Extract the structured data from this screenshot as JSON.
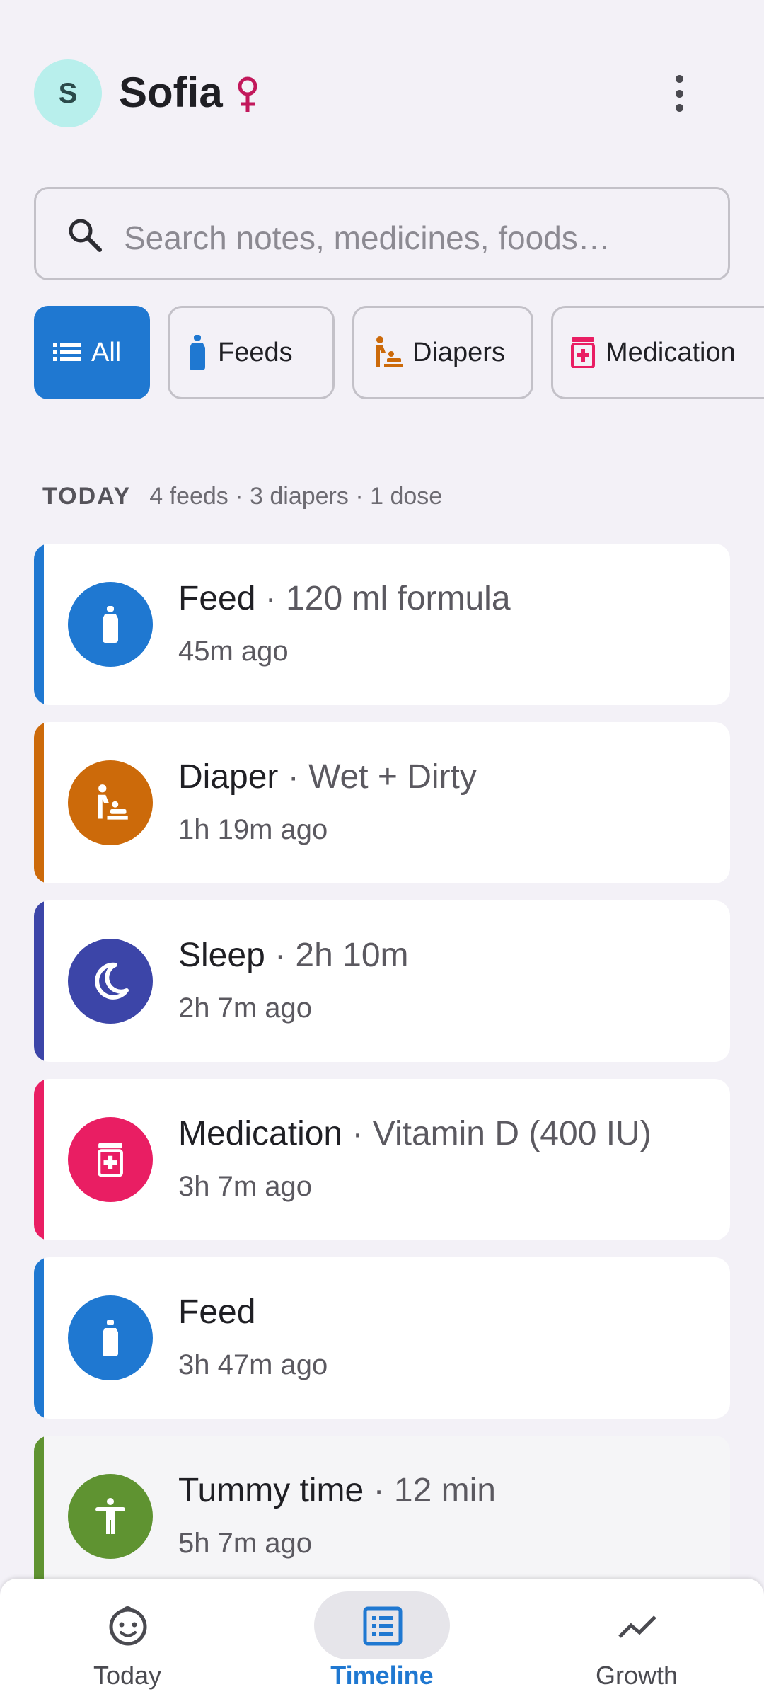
{
  "header": {
    "avatar_initial": "S",
    "baby_name": "Sofia",
    "gender_symbol_color": "#c2185b"
  },
  "search": {
    "placeholder": "Search notes, medicines, foods…"
  },
  "filters": [
    {
      "label": "All",
      "icon": "list-icon",
      "active": true
    },
    {
      "label": "Feeds",
      "icon": "bottle-icon",
      "active": false,
      "color": "#1f78d1"
    },
    {
      "label": "Diapers",
      "icon": "baby-changing-icon",
      "active": false,
      "color": "#cc6a0a"
    },
    {
      "label": "Medication",
      "icon": "medication-icon",
      "active": false,
      "color": "#e91e63"
    }
  ],
  "section": {
    "title": "TODAY",
    "summary": "4 feeds · 3 diapers · 1 dose"
  },
  "entries": [
    {
      "type": "Feed",
      "detail": "· 120 ml formula",
      "time": "45m ago",
      "icon": "bottle-icon",
      "color": "#1f78d1"
    },
    {
      "type": "Diaper",
      "detail": "· Wet + Dirty",
      "time": "1h 19m ago",
      "icon": "baby-changing-icon",
      "color": "#cc6a0a"
    },
    {
      "type": "Sleep",
      "detail": "· 2h 10m",
      "time": "2h 7m ago",
      "icon": "moon-icon",
      "color": "#3c45a8"
    },
    {
      "type": "Medication",
      "detail": "· Vitamin D (400 IU)",
      "time": "3h 7m ago",
      "icon": "medication-icon",
      "color": "#e91e63"
    },
    {
      "type": "Feed",
      "detail": "",
      "time": "3h 47m ago",
      "icon": "bottle-icon",
      "color": "#1f78d1"
    },
    {
      "type": "Tummy time",
      "detail": "· 12 min",
      "time": "5h 7m ago",
      "icon": "child-icon",
      "color": "#5f9331"
    }
  ],
  "nav": [
    {
      "label": "Today",
      "icon": "baby-face-icon",
      "active": false
    },
    {
      "label": "Timeline",
      "icon": "list-alt-icon",
      "active": true
    },
    {
      "label": "Growth",
      "icon": "trend-icon",
      "active": false
    }
  ]
}
